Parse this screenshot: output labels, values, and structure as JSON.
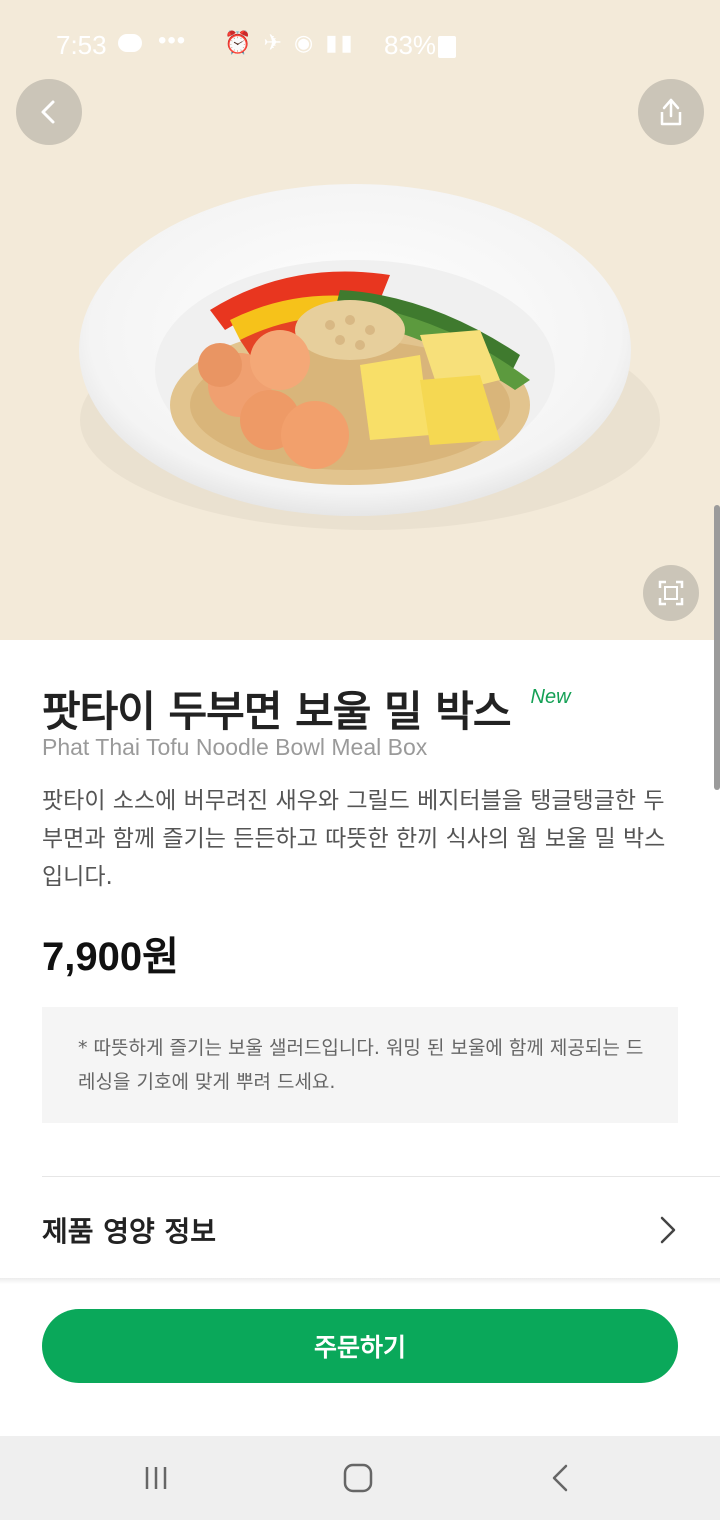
{
  "status_bar": {
    "time": "7:53",
    "notifications": "•••",
    "battery": "83%"
  },
  "product": {
    "title_ko": "팟타이 두부면 보울 밀 박스",
    "badge": "New",
    "title_en": "Phat Thai Tofu Noodle Bowl Meal Box",
    "description": "팟타이 소스에 버무려진 새우와 그릴드 베지터블을 탱글탱글한 두부면과 함께 즐기는 든든하고 따뜻한 한끼 식사의 웜 보울 밀 박스입니다.",
    "price": "7,900원",
    "notice": "* 따뜻하게 즐기는 보울 샐러드입니다. 워밍 된 보울에 함께 제공되는 드레싱을 기호에 맞게 뿌려 드세요."
  },
  "nutrition_link": {
    "label": "제품 영양 정보"
  },
  "order_button": {
    "label": "주문하기"
  },
  "icons": [
    "back-arrow-icon",
    "share-icon",
    "fullscreen-icon",
    "chevron-right-icon",
    "recent-apps-icon",
    "home-icon",
    "nav-back-icon"
  ],
  "colors": {
    "accent": "#0aa85a",
    "hero_background": "#f3ead9",
    "badge": "#14a055"
  }
}
